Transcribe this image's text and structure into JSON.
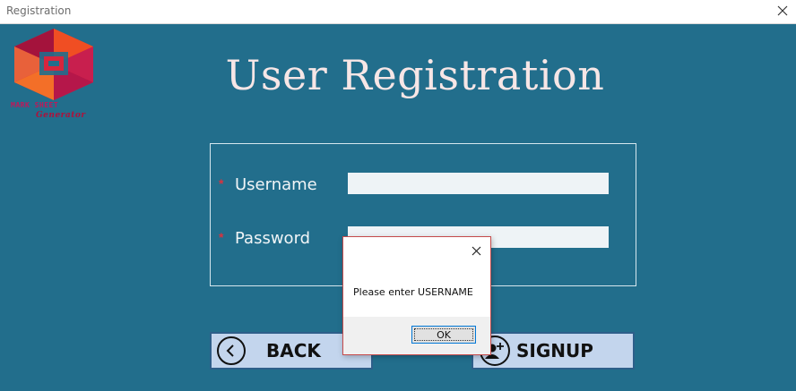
{
  "window": {
    "title": "Registration",
    "close_icon": "close-icon"
  },
  "logo": {
    "line1": "MARK SHEET",
    "line2": "Generator",
    "colors": [
      "#c81f4e",
      "#e2492c",
      "#8f1a3f",
      "#f26b2f"
    ]
  },
  "heading": "User Registration",
  "form": {
    "required_marker": "*",
    "username": {
      "label": "Username",
      "value": ""
    },
    "password": {
      "label": "Password",
      "value": ""
    }
  },
  "buttons": {
    "back": {
      "label": "BACK",
      "icon": "chevron-left-circle-icon"
    },
    "signup": {
      "label": "SIGNUP",
      "icon": "add-user-icon"
    }
  },
  "dialog": {
    "message": "Please enter USERNAME",
    "ok_label": "OK",
    "close_icon": "close-icon"
  },
  "colors": {
    "background": "#226e8c",
    "heading": "#f7e6e6",
    "required": "#d8333f",
    "button_bg": "#c3d5ed",
    "dialog_border": "#c64b4b",
    "ok_border": "#0078d7"
  }
}
